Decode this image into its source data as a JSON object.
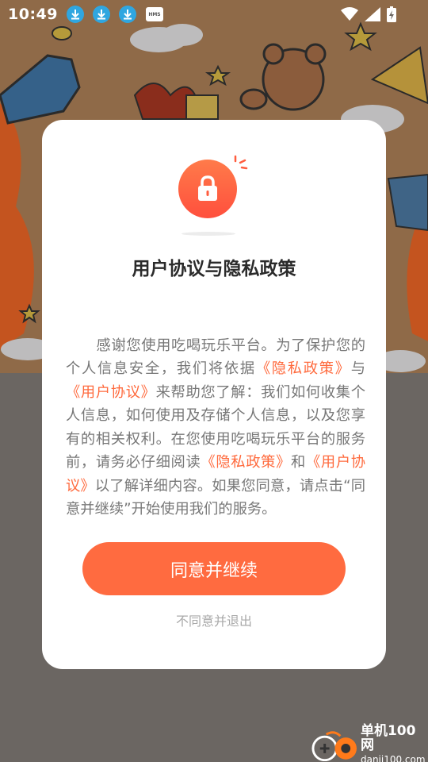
{
  "status_bar": {
    "time": "10:49",
    "hms_label": "HMS",
    "icons": [
      "download-icon",
      "download-icon",
      "download-icon",
      "hms-icon",
      "wifi-icon",
      "signal-icon",
      "battery-charging-icon"
    ]
  },
  "dialog": {
    "title": "用户协议与隐私政策",
    "body_segments": [
      {
        "text": "感谢您使用吃喝玩乐平台。为了保护您的个人信息安全，我们将依据",
        "link": false
      },
      {
        "text": "《隐私政策》",
        "link": true
      },
      {
        "text": "与",
        "link": false
      },
      {
        "text": "《用户协议》",
        "link": true
      },
      {
        "text": "来帮助您了解：我们如何收集个人信息，如何使用及存储个人信息，以及您享有的相关权利。在您使用吃喝玩乐平台的服务前，请务必仔细阅读",
        "link": false
      },
      {
        "text": "《隐私政策》",
        "link": true
      },
      {
        "text": "和",
        "link": false
      },
      {
        "text": "《用户协议》",
        "link": true
      },
      {
        "text": "以了解详细内容。如果您同意，请点击“同意并继续”开始使用我们的服务。",
        "link": false
      }
    ],
    "agree_label": "同意并继续",
    "decline_label": "不同意并退出"
  },
  "watermark": {
    "cn": "单机100网",
    "en": "danji100.com"
  },
  "colors": {
    "accent": "#ff6b40",
    "link": "#ff6a3d",
    "status_icon_blue": "#2fa6e0",
    "dim_background": "#6b6662"
  }
}
